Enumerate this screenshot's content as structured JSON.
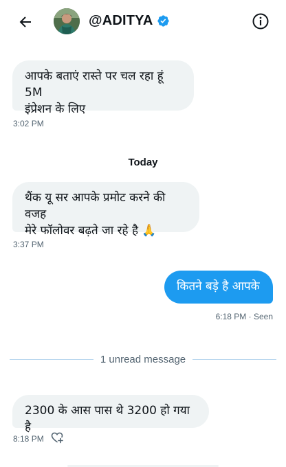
{
  "header": {
    "username": "@ADITYA",
    "back_icon": "arrow-left-icon",
    "verified_icon": "verified-badge-icon",
    "info_icon": "info-icon",
    "accent": "#1d9bf0"
  },
  "messages": [
    {
      "text_line1": "आपके बताएं रास्ते पर चल रहा हूं 5M",
      "text_line2": "इंप्रेशन के लिए",
      "time": "3:02 PM"
    },
    {
      "text_line1": "थैंक यू सर आपके प्रमोट करने की वजह",
      "text_line2": "मेरे फॉलोवर बढ़ते जा रहे है 🙏",
      "time": "3:37 PM"
    },
    {
      "text": "कितने बड़े है आपके",
      "time": "6:18 PM · Seen"
    },
    {
      "text": "2300 के आस पास थे 3200 हो गया है",
      "time": "8:18 PM"
    }
  ],
  "day_separator": "Today",
  "unread": "1 unread message",
  "reaction_icon": "heart-add-icon"
}
